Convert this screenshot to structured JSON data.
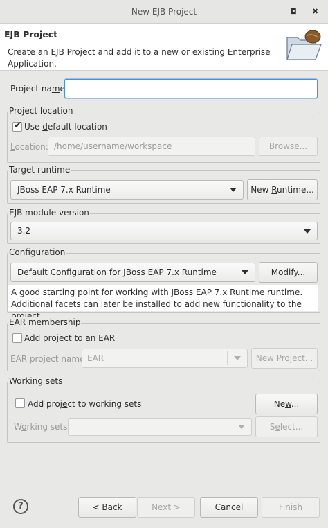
{
  "window": {
    "title": "New EJB Project",
    "minimize_glyph": "◘",
    "close_glyph": "✖"
  },
  "banner": {
    "heading": "EJB Project",
    "description": "Create an EJB Project and add it to a new or existing Enterprise Application.",
    "icon": "folder-with-bean-icon"
  },
  "project_name": {
    "label_pre": "Project na",
    "label_u": "m",
    "label_post": "e:",
    "value": ""
  },
  "project_location": {
    "group_label": "Project location",
    "use_default_pre": "Use ",
    "use_default_u": "d",
    "use_default_post": "efault location",
    "use_default_checked": true,
    "check_glyph": "✔",
    "location_label_u": "L",
    "location_label_post": "ocation:",
    "location_value": "/home/username/workspace",
    "browse_pre": "Browse...",
    "browse_u": "",
    "browse_post": ""
  },
  "target_runtime": {
    "group_label": "Target runtime",
    "selected": "JBoss EAP 7.x Runtime",
    "new_runtime_pre": "New ",
    "new_runtime_u": "R",
    "new_runtime_post": "untime..."
  },
  "ejb_module": {
    "group_label": "EJB module version",
    "selected": "3.2"
  },
  "configuration": {
    "group_label": "Configuration",
    "selected": "Default Configuration for JBoss EAP 7.x Runtime",
    "modify_pre": "Mod",
    "modify_u": "i",
    "modify_post": "fy...",
    "description": "A good starting point for working with JBoss EAP 7.x Runtime runtime. Additional facets can later be installed to add new functionality to the project."
  },
  "ear_membership": {
    "group_label": "EAR membership",
    "add_to_ear": "Add project to an EAR",
    "add_to_ear_checked": false,
    "ear_project_label": "EAR project name:",
    "ear_project_value": "EAR",
    "new_project_pre": "New ",
    "new_project_u": "P",
    "new_project_post": "roject..."
  },
  "working_sets": {
    "group_label": "Working sets",
    "add_label_pre": "Add proj",
    "add_label_u": "e",
    "add_label_post": "ct to working sets",
    "add_checked": false,
    "new_pre": "Ne",
    "new_u": "w",
    "new_post": "...",
    "working_sets_label_pre": "W",
    "working_sets_label_u": "o",
    "working_sets_label_post": "rking sets:",
    "working_sets_value": "",
    "select_pre": "S",
    "select_u": "e",
    "select_post": "lect..."
  },
  "footer": {
    "help_glyph": "?",
    "back": "< Back",
    "next": "Next >",
    "cancel": "Cancel",
    "finish": "Finish"
  }
}
